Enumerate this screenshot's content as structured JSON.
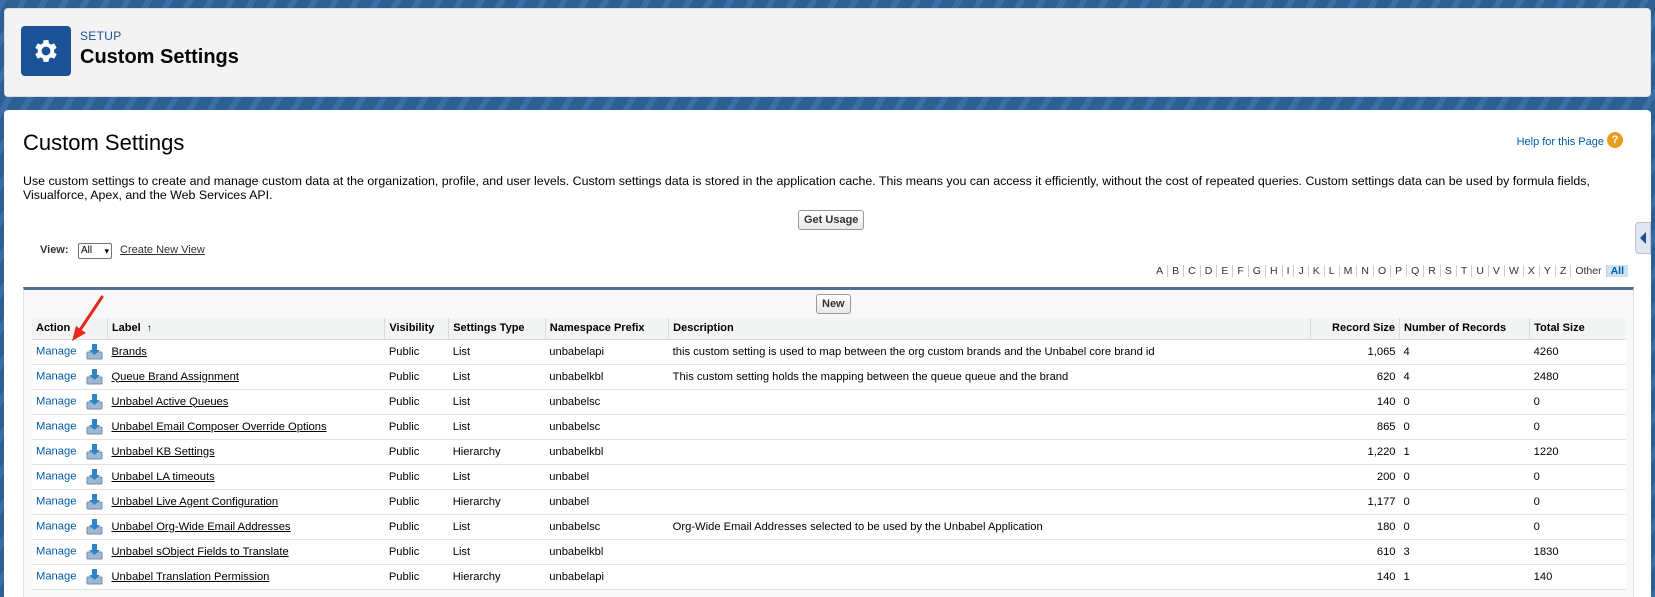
{
  "header": {
    "breadcrumb": "SETUP",
    "title": "Custom Settings"
  },
  "page": {
    "title": "Custom Settings",
    "help_link": "Help for this Page",
    "help_icon": "?",
    "description": "Use custom settings to create and manage custom data at the organization, profile, and user levels. Custom settings data is stored in the application cache. This means you can access it efficiently, without the cost of repeated queries. Custom settings data can be used by formula fields, Visualforce, Apex, and the Web Services API.",
    "get_usage_label": "Get Usage",
    "view_label": "View:",
    "view_selected": "All",
    "create_view_label": "Create New View",
    "new_label": "New"
  },
  "alphabet": [
    "A",
    "B",
    "C",
    "D",
    "E",
    "F",
    "G",
    "H",
    "I",
    "J",
    "K",
    "L",
    "M",
    "N",
    "O",
    "P",
    "Q",
    "R",
    "S",
    "T",
    "U",
    "V",
    "W",
    "X",
    "Y",
    "Z",
    "Other",
    "All"
  ],
  "alphabet_selected": "All",
  "table": {
    "columns": [
      "Action",
      "Label",
      "Visibility",
      "Settings Type",
      "Namespace Prefix",
      "Description",
      "Record Size",
      "Number of Records",
      "Total Size"
    ],
    "sort_indicator": "↑",
    "rows": [
      {
        "action": "Manage",
        "label": "Brands",
        "visibility": "Public",
        "type": "List",
        "namespace": "unbabelapi",
        "description": "this custom setting is used to map between the org custom brands and the Unbabel core brand id",
        "record_size": "1,065",
        "num_records": "4",
        "total_size": "4260"
      },
      {
        "action": "Manage",
        "label": "Queue Brand Assignment",
        "visibility": "Public",
        "type": "List",
        "namespace": "unbabelkbl",
        "description": "This custom setting holds the mapping between the queue queue and the brand",
        "record_size": "620",
        "num_records": "4",
        "total_size": "2480"
      },
      {
        "action": "Manage",
        "label": "Unbabel Active Queues",
        "visibility": "Public",
        "type": "List",
        "namespace": "unbabelsc",
        "description": "",
        "record_size": "140",
        "num_records": "0",
        "total_size": "0"
      },
      {
        "action": "Manage",
        "label": "Unbabel Email Composer Override Options",
        "visibility": "Public",
        "type": "List",
        "namespace": "unbabelsc",
        "description": "",
        "record_size": "865",
        "num_records": "0",
        "total_size": "0"
      },
      {
        "action": "Manage",
        "label": "Unbabel KB Settings",
        "visibility": "Public",
        "type": "Hierarchy",
        "namespace": "unbabelkbl",
        "description": "",
        "record_size": "1,220",
        "num_records": "1",
        "total_size": "1220"
      },
      {
        "action": "Manage",
        "label": "Unbabel LA timeouts",
        "visibility": "Public",
        "type": "List",
        "namespace": "unbabel",
        "description": "",
        "record_size": "200",
        "num_records": "0",
        "total_size": "0"
      },
      {
        "action": "Manage",
        "label": "Unbabel Live Agent Configuration",
        "visibility": "Public",
        "type": "Hierarchy",
        "namespace": "unbabel",
        "description": "",
        "record_size": "1,177",
        "num_records": "0",
        "total_size": "0"
      },
      {
        "action": "Manage",
        "label": "Unbabel Org-Wide Email Addresses",
        "visibility": "Public",
        "type": "List",
        "namespace": "unbabelsc",
        "description": "Org-Wide Email Addresses selected to be used by the Unbabel Application",
        "record_size": "180",
        "num_records": "0",
        "total_size": "0"
      },
      {
        "action": "Manage",
        "label": "Unbabel sObject Fields to Translate",
        "visibility": "Public",
        "type": "List",
        "namespace": "unbabelkbl",
        "description": "",
        "record_size": "610",
        "num_records": "3",
        "total_size": "1830"
      },
      {
        "action": "Manage",
        "label": "Unbabel Translation Permission",
        "visibility": "Public",
        "type": "Hierarchy",
        "namespace": "unbabelapi",
        "description": "",
        "record_size": "140",
        "num_records": "1",
        "total_size": "140"
      }
    ]
  },
  "colors": {
    "brand": "#1b5297",
    "link": "#015ba7",
    "annotation_arrow": "#e8281e"
  }
}
